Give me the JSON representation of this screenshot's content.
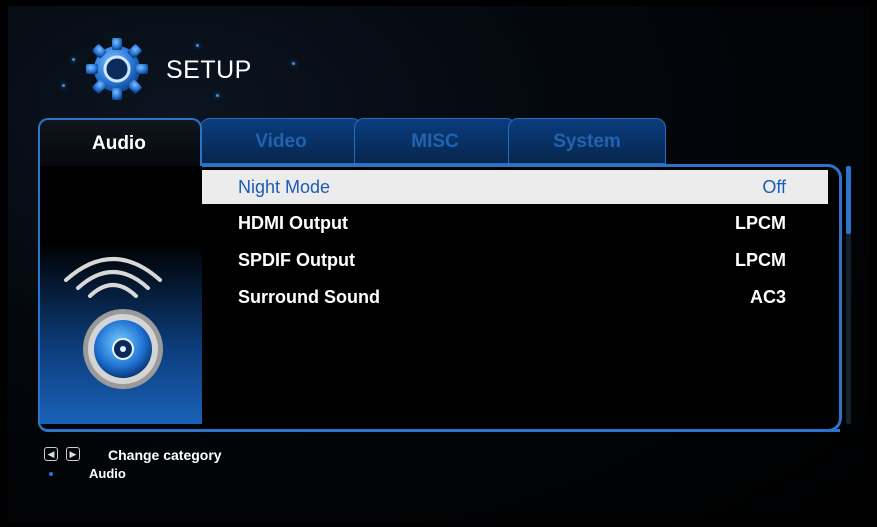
{
  "header": {
    "title": "SETUP",
    "icon": "gear-icon"
  },
  "tabs": [
    {
      "label": "Audio",
      "active": true
    },
    {
      "label": "Video",
      "active": false
    },
    {
      "label": "MISC",
      "active": false
    },
    {
      "label": "System",
      "active": false
    }
  ],
  "settings": [
    {
      "label": "Night Mode",
      "value": "Off",
      "selected": true
    },
    {
      "label": "HDMI Output",
      "value": "LPCM",
      "selected": false
    },
    {
      "label": "SPDIF Output",
      "value": "LPCM",
      "selected": false
    },
    {
      "label": "Surround Sound",
      "value": "AC3",
      "selected": false
    }
  ],
  "footer": {
    "hint": "Change category",
    "current_category": "Audio",
    "left_key_icon": "arrow-left-key-icon",
    "right_key_icon": "arrow-right-key-icon"
  },
  "colors": {
    "accent": "#2c74c9",
    "selected_row_bg": "#ececec",
    "selected_row_text": "#1e5bb5"
  }
}
